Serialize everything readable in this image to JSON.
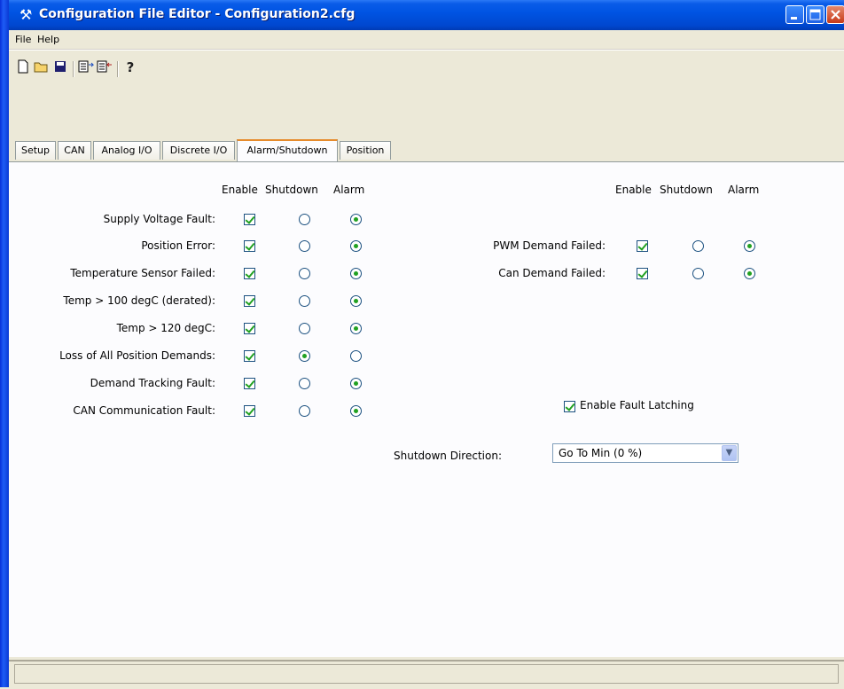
{
  "window": {
    "title": "Configuration File Editor - Configuration2.cfg",
    "icon": "tools-icon",
    "title_color": "#0054e3"
  },
  "menu": {
    "file": "File",
    "help": "Help"
  },
  "toolbar": {
    "icons": [
      "new-file-icon",
      "open-folder-icon",
      "save-icon",
      "export-icon",
      "import-icon",
      "help-icon"
    ]
  },
  "tabs": [
    {
      "label": "Setup",
      "active": false
    },
    {
      "label": "CAN",
      "active": false
    },
    {
      "label": "Analog I/O",
      "active": false
    },
    {
      "label": "Discrete I/O",
      "active": false
    },
    {
      "label": "Alarm/Shutdown",
      "active": true
    },
    {
      "label": "Position",
      "active": false
    }
  ],
  "left_table": {
    "headers": {
      "enable": "Enable",
      "shutdown": "Shutdown",
      "alarm": "Alarm"
    },
    "rows": [
      {
        "label": "Supply Voltage Fault:",
        "enabled": true,
        "action": "alarm"
      },
      {
        "label": "Position Error:",
        "enabled": true,
        "action": "alarm"
      },
      {
        "label": "Temperature Sensor Failed:",
        "enabled": true,
        "action": "alarm"
      },
      {
        "label": "Temp > 100 degC (derated):",
        "enabled": true,
        "action": "alarm"
      },
      {
        "label": "Temp > 120 degC:",
        "enabled": true,
        "action": "alarm"
      },
      {
        "label": "Loss of All Position Demands:",
        "enabled": true,
        "action": "shutdown"
      },
      {
        "label": "Demand Tracking Fault:",
        "enabled": true,
        "action": "alarm"
      },
      {
        "label": "CAN Communication Fault:",
        "enabled": true,
        "action": "alarm"
      }
    ]
  },
  "right_table": {
    "headers": {
      "enable": "Enable",
      "shutdown": "Shutdown",
      "alarm": "Alarm"
    },
    "rows": [
      {
        "label": "PWM Demand Failed:",
        "enabled": true,
        "action": "alarm"
      },
      {
        "label": "Can Demand Failed:",
        "enabled": true,
        "action": "alarm"
      }
    ]
  },
  "fault_latching": {
    "label": "Enable Fault Latching",
    "checked": true
  },
  "shutdown_direction": {
    "label": "Shutdown Direction:",
    "value": "Go To Min (0 %)"
  }
}
